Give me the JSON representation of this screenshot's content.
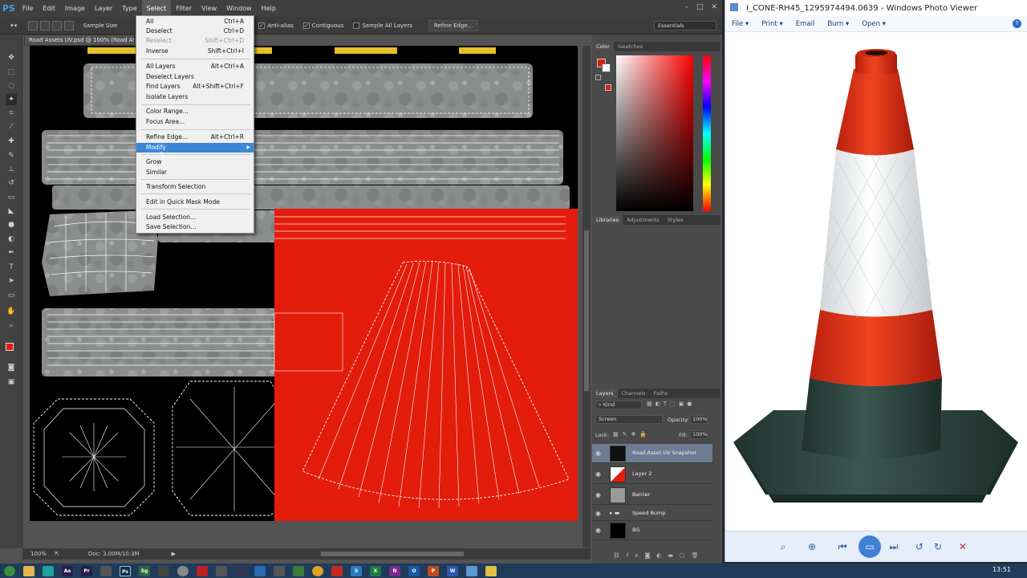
{
  "photoshop": {
    "logo": "PS",
    "menu": [
      "File",
      "Edit",
      "Image",
      "Layer",
      "Type",
      "Select",
      "Filter",
      "View",
      "Window",
      "Help"
    ],
    "window_controls": [
      "–",
      "□",
      "✕"
    ],
    "options": {
      "sample_size": "Sample Size",
      "anti_alias": "Anti-alias",
      "contiguous": "Contiguous",
      "sample_all_layers": "Sample All Layers",
      "refine_edge": "Refine Edge..."
    },
    "workspace": "Essentials",
    "document_tab": "Road Assets UV.psd @ 100% (Road Assets",
    "status": {
      "zoom": "100%",
      "doc": "Doc: 3.00M/10.3M"
    },
    "select_menu": [
      {
        "label": "All",
        "shortcut": "Ctrl+A",
        "disabled": false
      },
      {
        "label": "Deselect",
        "shortcut": "Ctrl+D",
        "disabled": false
      },
      {
        "label": "Reselect",
        "shortcut": "Shift+Ctrl+D",
        "disabled": true
      },
      {
        "label": "Inverse",
        "shortcut": "Shift+Ctrl+I",
        "disabled": false
      },
      {
        "label": "All Layers",
        "shortcut": "Alt+Ctrl+A",
        "disabled": false
      },
      {
        "label": "Deselect Layers",
        "shortcut": "",
        "disabled": false
      },
      {
        "label": "Find Layers",
        "shortcut": "Alt+Shift+Ctrl+F",
        "disabled": false
      },
      {
        "label": "Isolate Layers",
        "shortcut": "",
        "disabled": false
      },
      {
        "label": "Color Range...",
        "shortcut": "",
        "disabled": false
      },
      {
        "label": "Focus Area...",
        "shortcut": "",
        "disabled": false
      },
      {
        "label": "Refine Edge...",
        "shortcut": "Alt+Ctrl+R",
        "disabled": false
      },
      {
        "label": "Modify",
        "shortcut": "",
        "disabled": false,
        "submenu": true
      },
      {
        "label": "Grow",
        "shortcut": "",
        "disabled": false
      },
      {
        "label": "Similar",
        "shortcut": "",
        "disabled": false
      },
      {
        "label": "Transform Selection",
        "shortcut": "",
        "disabled": false
      },
      {
        "label": "Edit in Quick Mask Mode",
        "shortcut": "",
        "disabled": false
      },
      {
        "label": "Load Selection...",
        "shortcut": "",
        "disabled": false
      },
      {
        "label": "Save Selection...",
        "shortcut": "",
        "disabled": false
      }
    ],
    "panels": {
      "color_tabs": [
        "Color",
        "Swatches"
      ],
      "library_tabs": [
        "Libraries",
        "Adjustments",
        "Styles"
      ],
      "layer_tabs": [
        "Layers",
        "Channels",
        "Paths"
      ],
      "kind_filter": "Kind",
      "blend_mode": "Screen",
      "opacity_label": "Opacity:",
      "opacity": "100%",
      "lock_label": "Lock:",
      "fill_label": "Fill:",
      "fill": "100%",
      "layers": [
        "Road Asset UV Snapshot",
        "Layer 2",
        "Barrier",
        "Speed Bump",
        "BG"
      ]
    },
    "colors": {
      "foreground": "#e11b0a",
      "background": "#ffffff",
      "canvas_red": "#e41c0b"
    }
  },
  "photo_viewer": {
    "title": "I_CONE-RH45_1295974494.0639 - Windows Photo Viewer",
    "menu": [
      "File",
      "Print",
      "Email",
      "Burn",
      "Open"
    ],
    "help": "?"
  },
  "taskbar": {
    "clock": "13:51"
  }
}
